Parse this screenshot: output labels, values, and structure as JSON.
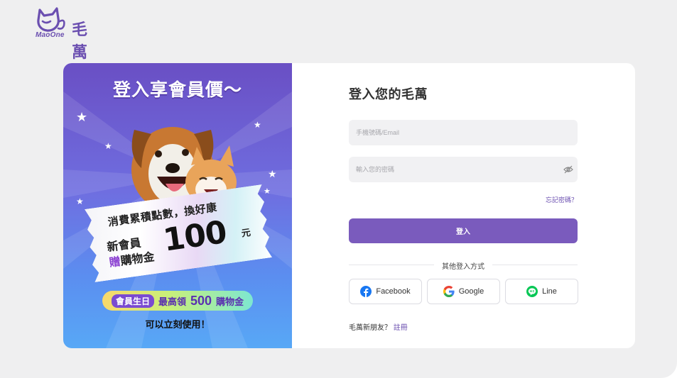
{
  "brand": {
    "logo_sub": "MaoOne",
    "name": "毛萬",
    "accent_color": "#7a5bbd"
  },
  "banner": {
    "title": "登入享會員價～",
    "ticket_line1": "消費累積點數，換好康",
    "ticket_line2": "新會員",
    "ticket_line3_prefix": "贈",
    "ticket_line3_rest": "購物金",
    "ticket_amount": "100",
    "ticket_unit": "元",
    "pill_chip": "會員生日",
    "pill_text1": "最高領",
    "pill_number": "500",
    "pill_text2": "購物金",
    "footer": "可以立刻使用！"
  },
  "login": {
    "title": "登入您的毛萬",
    "account_placeholder": "手機號碼/Email",
    "password_placeholder": "輸入您的密碼",
    "forgot_label": "忘記密碼？",
    "submit_label": "登入",
    "other_methods_label": "其他登入方式",
    "social": [
      {
        "label": "Facebook",
        "icon": "facebook-icon",
        "color": "#1877f2"
      },
      {
        "label": "Google",
        "icon": "google-icon",
        "color": "#4285f4"
      },
      {
        "label": "Line",
        "icon": "line-icon",
        "color": "#06c755"
      }
    ],
    "signup_prompt": "毛萬新朋友？",
    "signup_link": "註冊"
  }
}
